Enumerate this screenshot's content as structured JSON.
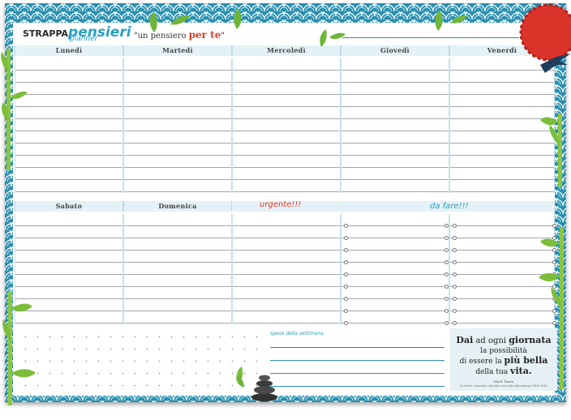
{
  "brand": {
    "strappa": "STRAPPA",
    "pensieri": "pensieri",
    "planner": "planner"
  },
  "slogan": {
    "prefix": "\"un pensiero ",
    "highlight": "per te",
    "suffix": "\""
  },
  "week_days": [
    "Lunedì",
    "Martedì",
    "Mercoledì",
    "Giovedì",
    "Venerdì"
  ],
  "weekend_days": [
    "Sabato",
    "Domenica"
  ],
  "sections": {
    "urgent": "urgente!!!",
    "todo": "da fare!!!",
    "expenses": "spese della settimana"
  },
  "quote": {
    "line1_a": "Dai",
    "line1_b": " ad ogni ",
    "line1_c": "giornata",
    "line2": "la possibilità",
    "line3_a": "di essere la ",
    "line3_b": "più bella",
    "line4_a": "della tua ",
    "line4_b": "vita.",
    "author": "Mark Twain",
    "author_desc": "Scrittore, umorista, aforista e docente statunitense 1835-1910"
  },
  "colors": {
    "teal": "#2b8fb0",
    "accent_red": "#e03c28",
    "brand_blue": "#27a1c4",
    "header_bg": "#e4f1f6",
    "bamboo": "#7cbd3a"
  },
  "decorations": [
    "wave-pattern-border",
    "bamboo-leaves-icon",
    "red-sun-icon",
    "swallow-bird-icon",
    "zen-stones-icon"
  ]
}
